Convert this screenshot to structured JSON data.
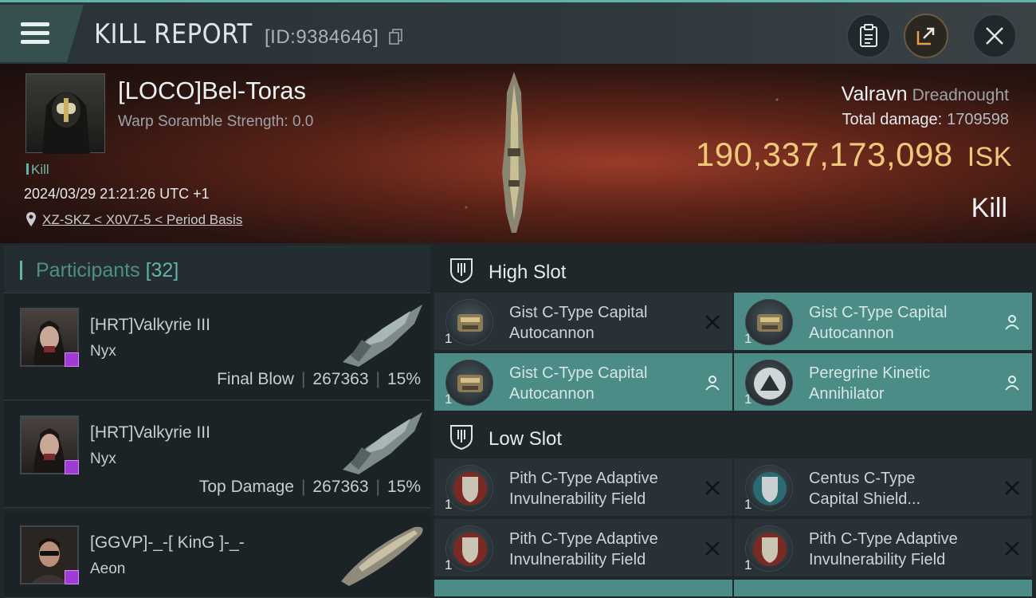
{
  "header": {
    "title": "KILL REPORT",
    "id_label": "[ID:9384646]"
  },
  "victim": {
    "name": "[LOCO]Bel-Toras",
    "warp_scramble": "Warp Soramble Strength: 0.0",
    "kill_tag": "Kill",
    "timestamp": "2024/03/29 21:21:26 UTC +1",
    "location": "XZ-SKZ < X0V7-5 < Period Basis",
    "ship_name": "Valravn",
    "ship_class": "Dreadnought",
    "total_damage_label": "Total damage:",
    "total_damage_value": "1709598",
    "isk_value": "190,337,173,098",
    "isk_unit": "ISK",
    "result": "Kill"
  },
  "participants": {
    "title": "Participants",
    "count": "[32]",
    "rows": [
      {
        "name": "[HRT]Valkyrie III",
        "ship": "Nyx",
        "role": "Final Blow",
        "damage": "267363",
        "percent": "15%"
      },
      {
        "name": "[HRT]Valkyrie III",
        "ship": "Nyx",
        "role": "Top Damage",
        "damage": "267363",
        "percent": "15%"
      },
      {
        "name": "[GGVP]-_-[ KinG ]-_-",
        "ship": "Aeon"
      }
    ]
  },
  "slots": {
    "high_title": "High Slot",
    "low_title": "Low Slot",
    "high": [
      {
        "qty": "1",
        "name1": "Gist C-Type Capital",
        "name2": "Autocannon"
      },
      {
        "qty": "1",
        "name1": "Gist C-Type Capital",
        "name2": "Autocannon"
      },
      {
        "qty": "1",
        "name1": "Gist C-Type Capital",
        "name2": "Autocannon"
      },
      {
        "qty": "1",
        "name1": "Peregrine Kinetic",
        "name2": "Annihilator"
      }
    ],
    "low": [
      {
        "qty": "1",
        "name1": "Pith C-Type Adaptive",
        "name2": "Invulnerability Field"
      },
      {
        "qty": "1",
        "name1": "Centus C-Type",
        "name2": "Capital Shield..."
      },
      {
        "qty": "1",
        "name1": "Pith C-Type Adaptive",
        "name2": "Invulnerability Field"
      },
      {
        "qty": "1",
        "name1": "Pith C-Type Adaptive",
        "name2": "Invulnerability Field"
      }
    ]
  },
  "colors": {
    "accent": "#5fb5aa",
    "isk": "#efc87a",
    "active_module": "#4b8c86",
    "badge": "#a13bd6"
  }
}
